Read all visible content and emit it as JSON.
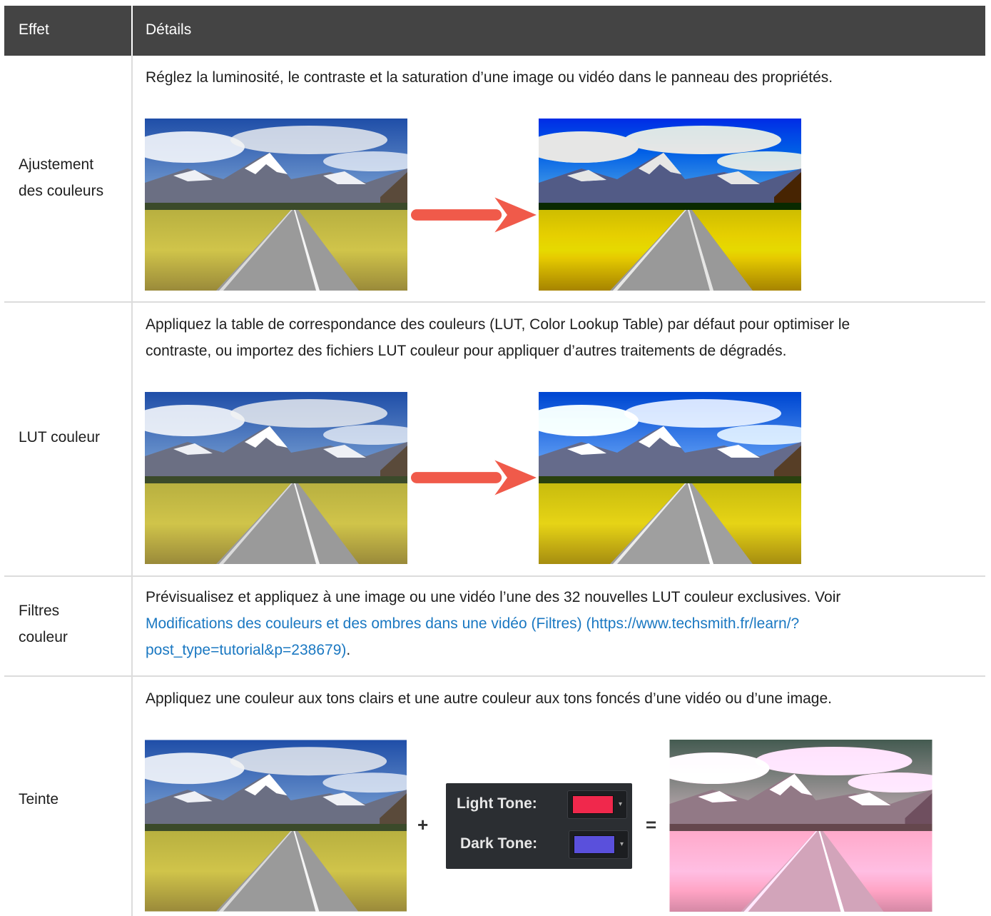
{
  "header": {
    "col1": "Effet",
    "col2": "Détails"
  },
  "rows": [
    {
      "effect": [
        "Ajustement",
        "des couleurs"
      ],
      "details": [
        "Réglez la luminosité, le contraste et la saturation d’une image ou vidéo dans le panneau des propriétés."
      ]
    },
    {
      "effect": [
        "LUT couleur"
      ],
      "details": [
        "Appliquez la table de correspondance des couleurs (LUT, Color Lookup Table) par défaut pour optimiser le",
        "contraste, ou importez des fichiers LUT couleur pour appliquer d’autres traitements de dégradés."
      ]
    },
    {
      "effect": [
        "Filtres",
        "couleur"
      ],
      "details_line1": "Prévisualisez et appliquez à une image ou une vidéo l’une des 32 nouvelles LUT couleur exclusives. Voir",
      "link_line1": "Modifications des couleurs et des ombres dans une vidéo (Filtres) (https://www.techsmith.fr/learn/?",
      "link_line2": "post_type=tutorial&p=238679)",
      "after_link": "."
    },
    {
      "effect": [
        "Teinte"
      ],
      "details": [
        "Appliquez une couleur aux tons clairs et une autre couleur aux tons foncés d’une vidéo ou d’une image."
      ],
      "tone_panel": {
        "light_label": "Light Tone:",
        "dark_label": "Dark Tone:",
        "light_color": "#f0284c",
        "dark_color": "#5a50dc"
      },
      "plus": "+",
      "equals": "="
    }
  ],
  "colors": {
    "header_bg": "#444444",
    "link": "#1a78c2",
    "arrow": "#f05a4a",
    "border": "#dcdcdc"
  }
}
